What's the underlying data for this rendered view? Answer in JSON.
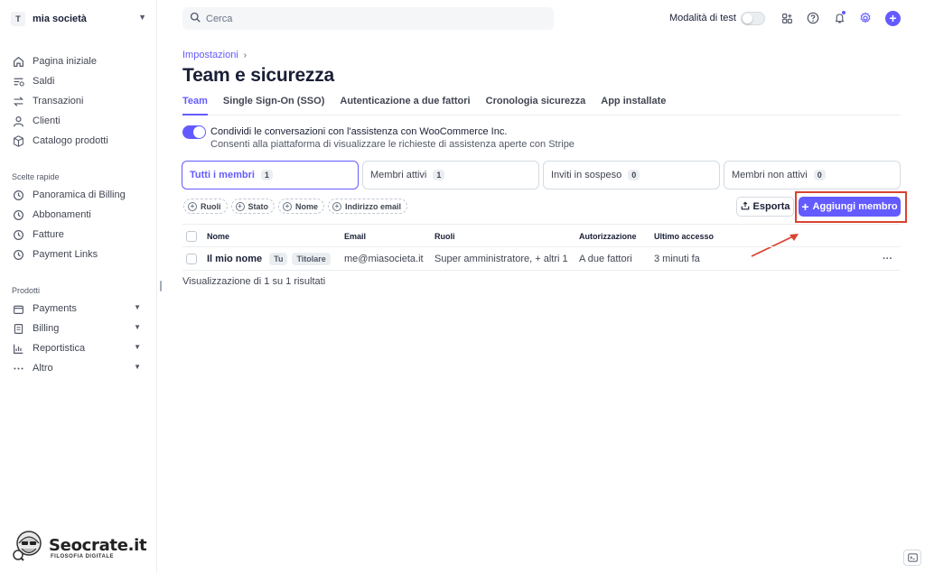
{
  "account": {
    "initial": "T",
    "name": "mia società"
  },
  "sidebar": {
    "main_items": [
      {
        "label": "Pagina iniziale",
        "icon": "home-icon"
      },
      {
        "label": "Saldi",
        "icon": "balance-icon"
      },
      {
        "label": "Transazioni",
        "icon": "transactions-icon"
      },
      {
        "label": "Clienti",
        "icon": "user-icon"
      },
      {
        "label": "Catalogo prodotti",
        "icon": "box-icon"
      }
    ],
    "quick_title": "Scelte rapide",
    "quick_items": [
      {
        "label": "Panoramica di Billing",
        "icon": "clock-icon"
      },
      {
        "label": "Abbonamenti",
        "icon": "clock-icon"
      },
      {
        "label": "Fatture",
        "icon": "clock-icon"
      },
      {
        "label": "Payment Links",
        "icon": "clock-icon"
      }
    ],
    "products_title": "Prodotti",
    "product_items": [
      {
        "label": "Payments",
        "icon": "wallet-icon"
      },
      {
        "label": "Billing",
        "icon": "document-icon"
      },
      {
        "label": "Reportistica",
        "icon": "bar-chart-icon"
      },
      {
        "label": "Altro",
        "icon": "more-icon"
      }
    ]
  },
  "watermark": {
    "brand": "Seocrate.it",
    "tagline": "FILOSOFIA DIGITALE"
  },
  "search": {
    "placeholder": "Cerca"
  },
  "topbar": {
    "test_mode_label": "Modalità di test"
  },
  "breadcrumb": {
    "parent": "Impostazioni"
  },
  "page": {
    "title": "Team e sicurezza"
  },
  "tabs": [
    "Team",
    "Single Sign-On (SSO)",
    "Autenticazione a due fattori",
    "Cronologia sicurezza",
    "App installate"
  ],
  "support_share": {
    "title": "Condividi le conversazioni con l'assistenza con WooCommerce Inc.",
    "description": "Consenti alla piattaforma di visualizzare le richieste di assistenza aperte con Stripe"
  },
  "filter_cards": [
    {
      "label": "Tutti i membri",
      "count": "1"
    },
    {
      "label": "Membri attivi",
      "count": "1"
    },
    {
      "label": "Inviti in sospeso",
      "count": "0"
    },
    {
      "label": "Membri non attivi",
      "count": "0"
    }
  ],
  "filters": [
    "Ruoli",
    "Stato",
    "Nome",
    "Indirizzo email"
  ],
  "actions": {
    "export": "Esporta",
    "add_member": "Aggiungi membro"
  },
  "table": {
    "columns": [
      "Nome",
      "Email",
      "Ruoli",
      "Autorizzazione",
      "Ultimo accesso"
    ],
    "rows": [
      {
        "name": "Il mio nome",
        "badges": [
          "Tu",
          "Titolare"
        ],
        "email": "me@miasocieta.it",
        "roles": "Super amministratore, + altri 1",
        "auth": "A due fattori",
        "last_access": "3 minuti fa"
      }
    ],
    "summary": "Visualizzazione di 1 su 1 risultati"
  },
  "colors": {
    "accent": "#635bff",
    "annotation": "#d9432f"
  }
}
